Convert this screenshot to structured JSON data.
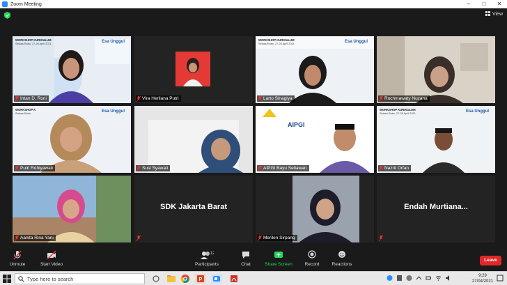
{
  "window": {
    "title": "Zoom Meeting",
    "controls": [
      "–",
      "□",
      "✕"
    ]
  },
  "view": {
    "label": "View"
  },
  "participants_grid": [
    {
      "name": "Intan D. Roni",
      "banner": {
        "l1": "WORKSHOP KURIKULUM",
        "l2": "Selasa-Rabu, 27-28 April 2021",
        "brand": "Esa Unggul"
      }
    },
    {
      "name": "Vira Herliana Putri"
    },
    {
      "name": "Larto Sinagiya",
      "banner": {
        "l1": "WORKSHOP KURIKULUM",
        "l2": "Selasa-Rabu, 27-28 April 2021",
        "brand": "Esa Unggul"
      }
    },
    {
      "name": "Rochmawaty Nuzana"
    },
    {
      "name": "Putri Rohiyawati",
      "banner": {
        "l1": "WORKSHOP K",
        "l2": "Selasa-Rabu",
        "brand": "Esa Unggul"
      }
    },
    {
      "name": "Susi Syawati"
    },
    {
      "name": "AIPGI Bayu Setiawan",
      "logo": "AIPGI"
    },
    {
      "name": "Nazrit Orfan",
      "banner": {
        "l1": "WORKSHOP KURIKULUM",
        "l2": "Selasa-Rabu, 27-28 April 2021",
        "brand": "Esa Unggul"
      }
    },
    {
      "name": "Aanita Rina Yani"
    },
    {
      "big": "SDK Jakarta Barat"
    },
    {
      "name": "Merilen Sirpang"
    },
    {
      "big": "Endah Murtiana..."
    }
  ],
  "toolbar": {
    "unmute": "Unmute",
    "start_video": "Start Video",
    "participants": "Participants",
    "participants_count": "12",
    "chat": "Chat",
    "share_screen": "Share Screen",
    "record": "Record",
    "reactions": "Reactions",
    "leave": "Leave"
  },
  "taskbar": {
    "search_placeholder": "Type here to search",
    "time": "9:29",
    "date": "27/04/2021"
  },
  "colors": {
    "active_speaker": "#c4e34b",
    "leave": "#e02828",
    "share": "#23d959",
    "zoom_blue": "#2d8cff"
  }
}
